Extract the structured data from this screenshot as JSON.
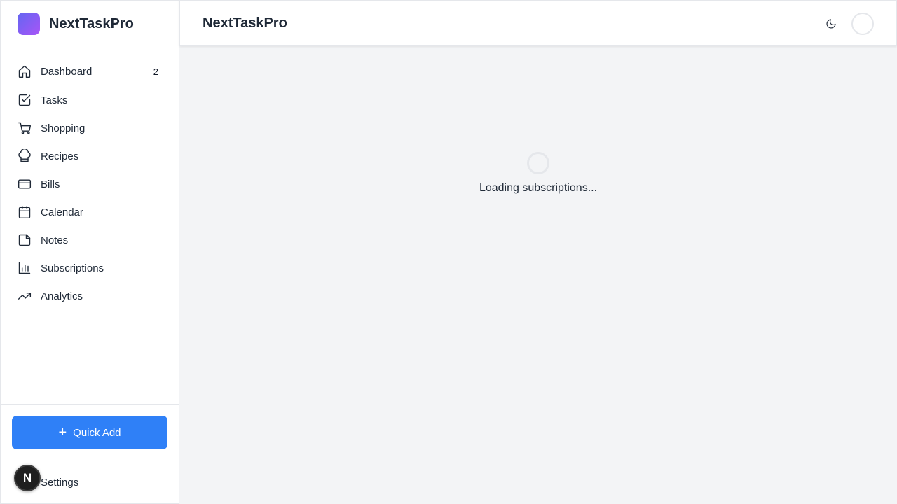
{
  "app": {
    "name": "NextTaskPro",
    "accent_color": "#2f80f7",
    "logo_gradient": [
      "#6366f1",
      "#a855f7"
    ]
  },
  "sidebar": {
    "items": [
      {
        "label": "Dashboard",
        "icon": "home-icon",
        "badge": "2"
      },
      {
        "label": "Tasks",
        "icon": "check-square-icon"
      },
      {
        "label": "Shopping",
        "icon": "shopping-cart-icon"
      },
      {
        "label": "Recipes",
        "icon": "chef-hat-icon"
      },
      {
        "label": "Bills",
        "icon": "credit-card-icon"
      },
      {
        "label": "Calendar",
        "icon": "calendar-icon"
      },
      {
        "label": "Notes",
        "icon": "sticky-note-icon"
      },
      {
        "label": "Subscriptions",
        "icon": "bar-chart-icon"
      },
      {
        "label": "Analytics",
        "icon": "trending-up-icon"
      }
    ],
    "quick_add_label": "Quick Add",
    "quick_add_icon": "plus-icon",
    "settings_label": "Settings",
    "dev_badge_letter": "N"
  },
  "header": {
    "title": "NextTaskPro",
    "theme_toggle_icon": "moon-icon"
  },
  "main": {
    "loading_text": "Loading subscriptions..."
  }
}
